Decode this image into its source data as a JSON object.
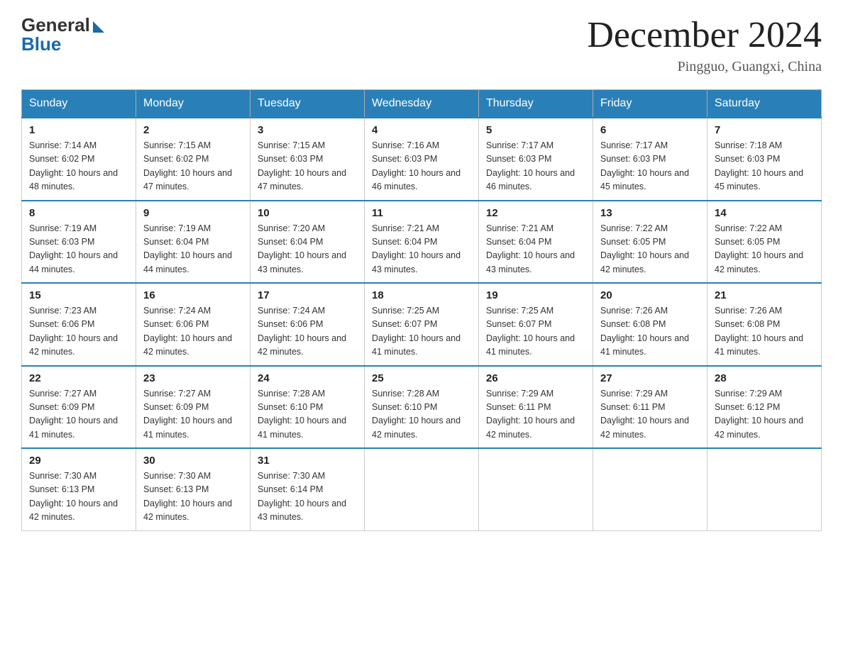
{
  "header": {
    "logo_general": "General",
    "logo_blue": "Blue",
    "month_title": "December 2024",
    "location": "Pingguo, Guangxi, China"
  },
  "calendar": {
    "days_of_week": [
      "Sunday",
      "Monday",
      "Tuesday",
      "Wednesday",
      "Thursday",
      "Friday",
      "Saturday"
    ],
    "weeks": [
      [
        {
          "day": "1",
          "sunrise": "7:14 AM",
          "sunset": "6:02 PM",
          "daylight": "10 hours and 48 minutes."
        },
        {
          "day": "2",
          "sunrise": "7:15 AM",
          "sunset": "6:02 PM",
          "daylight": "10 hours and 47 minutes."
        },
        {
          "day": "3",
          "sunrise": "7:15 AM",
          "sunset": "6:03 PM",
          "daylight": "10 hours and 47 minutes."
        },
        {
          "day": "4",
          "sunrise": "7:16 AM",
          "sunset": "6:03 PM",
          "daylight": "10 hours and 46 minutes."
        },
        {
          "day": "5",
          "sunrise": "7:17 AM",
          "sunset": "6:03 PM",
          "daylight": "10 hours and 46 minutes."
        },
        {
          "day": "6",
          "sunrise": "7:17 AM",
          "sunset": "6:03 PM",
          "daylight": "10 hours and 45 minutes."
        },
        {
          "day": "7",
          "sunrise": "7:18 AM",
          "sunset": "6:03 PM",
          "daylight": "10 hours and 45 minutes."
        }
      ],
      [
        {
          "day": "8",
          "sunrise": "7:19 AM",
          "sunset": "6:03 PM",
          "daylight": "10 hours and 44 minutes."
        },
        {
          "day": "9",
          "sunrise": "7:19 AM",
          "sunset": "6:04 PM",
          "daylight": "10 hours and 44 minutes."
        },
        {
          "day": "10",
          "sunrise": "7:20 AM",
          "sunset": "6:04 PM",
          "daylight": "10 hours and 43 minutes."
        },
        {
          "day": "11",
          "sunrise": "7:21 AM",
          "sunset": "6:04 PM",
          "daylight": "10 hours and 43 minutes."
        },
        {
          "day": "12",
          "sunrise": "7:21 AM",
          "sunset": "6:04 PM",
          "daylight": "10 hours and 43 minutes."
        },
        {
          "day": "13",
          "sunrise": "7:22 AM",
          "sunset": "6:05 PM",
          "daylight": "10 hours and 42 minutes."
        },
        {
          "day": "14",
          "sunrise": "7:22 AM",
          "sunset": "6:05 PM",
          "daylight": "10 hours and 42 minutes."
        }
      ],
      [
        {
          "day": "15",
          "sunrise": "7:23 AM",
          "sunset": "6:06 PM",
          "daylight": "10 hours and 42 minutes."
        },
        {
          "day": "16",
          "sunrise": "7:24 AM",
          "sunset": "6:06 PM",
          "daylight": "10 hours and 42 minutes."
        },
        {
          "day": "17",
          "sunrise": "7:24 AM",
          "sunset": "6:06 PM",
          "daylight": "10 hours and 42 minutes."
        },
        {
          "day": "18",
          "sunrise": "7:25 AM",
          "sunset": "6:07 PM",
          "daylight": "10 hours and 41 minutes."
        },
        {
          "day": "19",
          "sunrise": "7:25 AM",
          "sunset": "6:07 PM",
          "daylight": "10 hours and 41 minutes."
        },
        {
          "day": "20",
          "sunrise": "7:26 AM",
          "sunset": "6:08 PM",
          "daylight": "10 hours and 41 minutes."
        },
        {
          "day": "21",
          "sunrise": "7:26 AM",
          "sunset": "6:08 PM",
          "daylight": "10 hours and 41 minutes."
        }
      ],
      [
        {
          "day": "22",
          "sunrise": "7:27 AM",
          "sunset": "6:09 PM",
          "daylight": "10 hours and 41 minutes."
        },
        {
          "day": "23",
          "sunrise": "7:27 AM",
          "sunset": "6:09 PM",
          "daylight": "10 hours and 41 minutes."
        },
        {
          "day": "24",
          "sunrise": "7:28 AM",
          "sunset": "6:10 PM",
          "daylight": "10 hours and 41 minutes."
        },
        {
          "day": "25",
          "sunrise": "7:28 AM",
          "sunset": "6:10 PM",
          "daylight": "10 hours and 42 minutes."
        },
        {
          "day": "26",
          "sunrise": "7:29 AM",
          "sunset": "6:11 PM",
          "daylight": "10 hours and 42 minutes."
        },
        {
          "day": "27",
          "sunrise": "7:29 AM",
          "sunset": "6:11 PM",
          "daylight": "10 hours and 42 minutes."
        },
        {
          "day": "28",
          "sunrise": "7:29 AM",
          "sunset": "6:12 PM",
          "daylight": "10 hours and 42 minutes."
        }
      ],
      [
        {
          "day": "29",
          "sunrise": "7:30 AM",
          "sunset": "6:13 PM",
          "daylight": "10 hours and 42 minutes."
        },
        {
          "day": "30",
          "sunrise": "7:30 AM",
          "sunset": "6:13 PM",
          "daylight": "10 hours and 42 minutes."
        },
        {
          "day": "31",
          "sunrise": "7:30 AM",
          "sunset": "6:14 PM",
          "daylight": "10 hours and 43 minutes."
        },
        null,
        null,
        null,
        null
      ]
    ]
  }
}
